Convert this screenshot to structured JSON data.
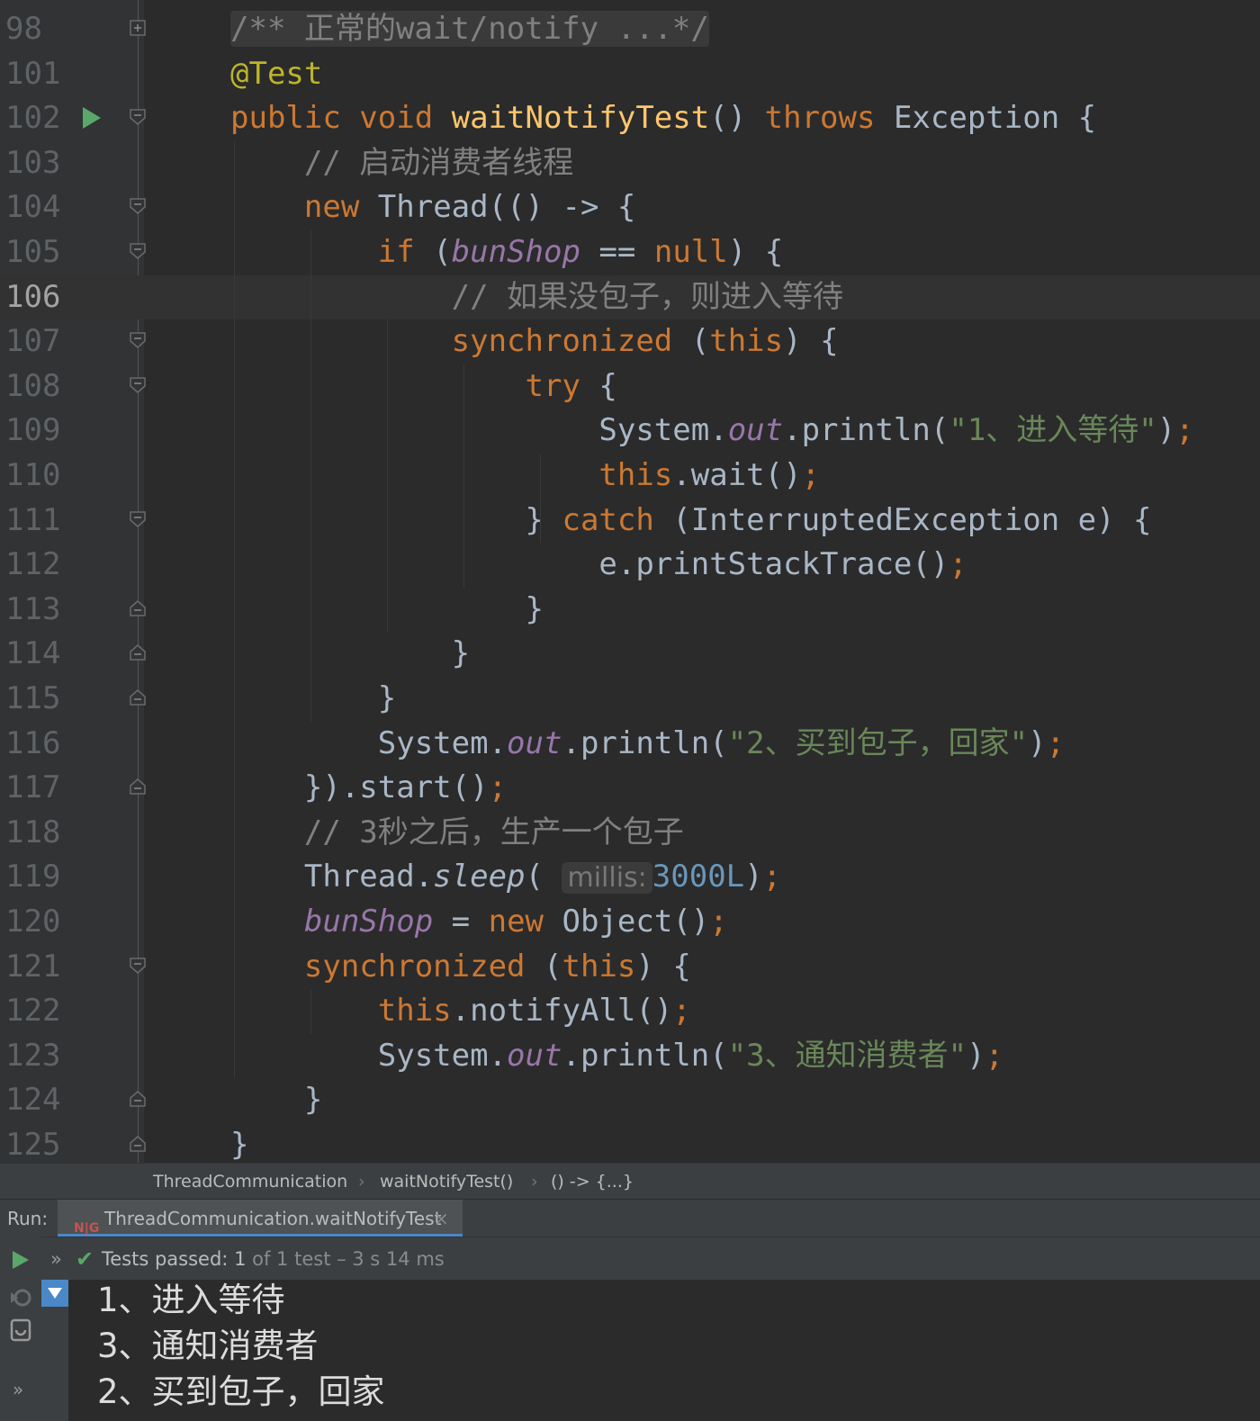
{
  "editor": {
    "lines": [
      {
        "n": "98",
        "fold": "plus",
        "html": "<span class=\"doc-fold\">/** 正常的wait/notify ...*/</span>"
      },
      {
        "n": "101",
        "html": "<span class=\"ann\">@Test</span>"
      },
      {
        "n": "102",
        "run": true,
        "fold": "minus",
        "html": "<span class=\"kw\">public void </span><span class=\"fn\">waitNotifyTest</span>() <span class=\"kw\">throws </span>Exception {"
      },
      {
        "n": "103",
        "html": "    <span class=\"cmt\">// 启动消费者线程</span>"
      },
      {
        "n": "104",
        "fold": "minus",
        "html": "    <span class=\"kw\">new </span>Thread(() -&gt; {"
      },
      {
        "n": "105",
        "fold": "minus",
        "html": "        <span class=\"kw\">if </span>(<span class=\"fld\">bunShop</span> == <span class=\"kw\">null</span>) {"
      },
      {
        "n": "106",
        "current": true,
        "html": "            <span class=\"cmt\">// 如果没包子，则进入等待</span>"
      },
      {
        "n": "107",
        "fold": "minus",
        "html": "            <span class=\"kw\">synchronized </span>(<span class=\"kw\">this</span>) {"
      },
      {
        "n": "108",
        "fold": "minus",
        "html": "                <span class=\"kw\">try </span>{"
      },
      {
        "n": "109",
        "html": "                    System.<span class=\"fld\">out</span>.println(<span class=\"str\">\"1、进入等待\"</span>)<span class=\"kw\">;</span>"
      },
      {
        "n": "110",
        "html": "                    <span class=\"kw\">this</span>.wait()<span class=\"kw\">;</span>"
      },
      {
        "n": "111",
        "fold": "minus",
        "html": "                } <span class=\"kw\">catch </span>(InterruptedException e) {"
      },
      {
        "n": "112",
        "html": "                    e.printStackTrace()<span class=\"kw\">;</span>"
      },
      {
        "n": "113",
        "fold": "end",
        "html": "                }"
      },
      {
        "n": "114",
        "fold": "end",
        "html": "            }"
      },
      {
        "n": "115",
        "fold": "end",
        "html": "        }"
      },
      {
        "n": "116",
        "html": "        System.<span class=\"fld\">out</span>.println(<span class=\"str\">\"2、买到包子，回家\"</span>)<span class=\"kw\">;</span>"
      },
      {
        "n": "117",
        "fold": "end",
        "html": "    }).start()<span class=\"kw\">;</span>"
      },
      {
        "n": "118",
        "html": "    <span class=\"cmt\">// 3秒之后，生产一个包子</span>"
      },
      {
        "n": "119",
        "html": "    Thread.<span class=\"smth\">sleep</span>( <span class=\"hint\">millis:</span><span class=\"num\">3000L</span>)<span class=\"kw\">;</span>"
      },
      {
        "n": "120",
        "html": "    <span class=\"fld\">bunShop</span> = <span class=\"kw\">new </span>Object()<span class=\"kw\">;</span>"
      },
      {
        "n": "121",
        "fold": "minus",
        "html": "    <span class=\"kw\">synchronized </span>(<span class=\"kw\">this</span>) {"
      },
      {
        "n": "122",
        "html": "        <span class=\"kw\">this</span>.notifyAll()<span class=\"kw\">;</span>"
      },
      {
        "n": "123",
        "html": "        System.<span class=\"fld\">out</span>.println(<span class=\"str\">\"3、通知消费者\"</span>)<span class=\"kw\">;</span>"
      },
      {
        "n": "124",
        "fold": "end",
        "html": "    }"
      },
      {
        "n": "125",
        "fold": "end",
        "html": "}"
      }
    ]
  },
  "breadcrumb": {
    "items": [
      "ThreadCommunication",
      "waitNotifyTest()",
      "() -> {...}"
    ],
    "separator": "›"
  },
  "run": {
    "label": "Run:",
    "tab_icon": "N|G",
    "tab_label": "ThreadCommunication.waitNotifyTest",
    "tab_close": "×"
  },
  "status": {
    "passed_label": "Tests passed:",
    "passed_count": "1",
    "rest": "of 1 test – 3 s 14 ms"
  },
  "console": {
    "lines": [
      "1、进入等待",
      "3、通知消费者",
      "2、买到包子，回家"
    ]
  },
  "colors": {
    "keyword": "#cc7832",
    "method": "#ffc66d",
    "string": "#6a8759",
    "field": "#9876aa",
    "comment": "#808080",
    "success": "#59a869",
    "accent": "#4a88c7"
  }
}
